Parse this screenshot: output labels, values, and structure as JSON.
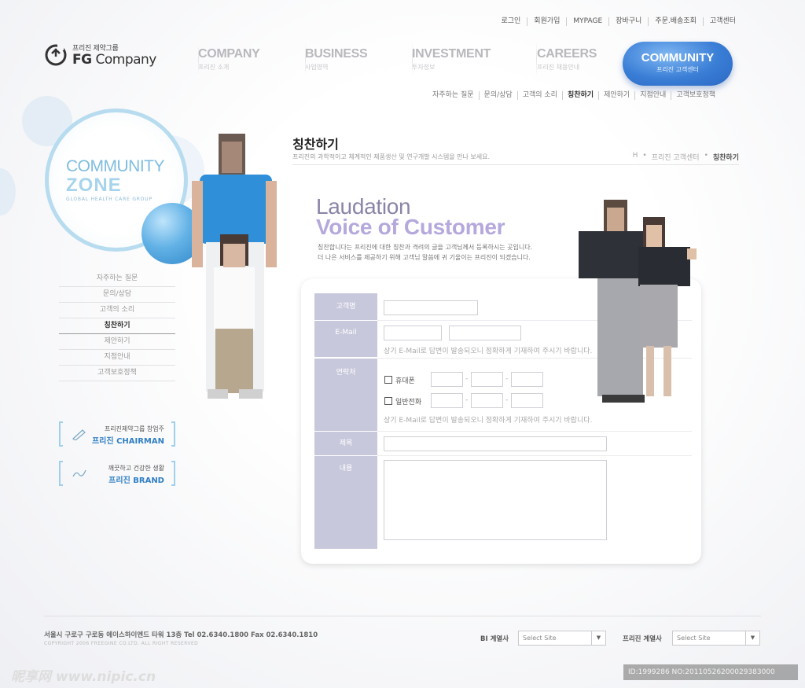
{
  "colors": {
    "accent": "#3a7ed6",
    "label_bg": "#c8c8dc",
    "zone": "#7fbde0"
  },
  "top_util": [
    "로그인",
    "회원가입",
    "MYPAGE",
    "장바구니",
    "주문.배송조회",
    "고객센터"
  ],
  "logo": {
    "sub": "프리진 제약그룹",
    "main_bold": "FG",
    "main": "Company",
    "icon": "logo-cycle-icon"
  },
  "gnb": [
    {
      "en": "COMPANY",
      "ko": "프리진 소개"
    },
    {
      "en": "BUSINESS",
      "ko": "사업영역"
    },
    {
      "en": "INVESTMENT",
      "ko": "투자정보"
    },
    {
      "en": "CAREERS",
      "ko": "프리진 채용안내"
    },
    {
      "en": "COMMUNITY",
      "ko": "프리진 고객센터"
    }
  ],
  "sub_nav": [
    "자주하는 질문",
    "문의/상담",
    "고객의 소리",
    "칭찬하기",
    "제안하기",
    "지점안내",
    "고객보호정책"
  ],
  "sub_nav_active": "칭찬하기",
  "zone": {
    "title": "COMMUNITY",
    "title2": "ZONE",
    "sub": "GLOBAL HEALTH CARE GROUP"
  },
  "lnb": [
    "자주하는 질문",
    "문의/상담",
    "고객의 소리",
    "칭찬하기",
    "제안하기",
    "지점안내",
    "고객보호정책"
  ],
  "banners": [
    {
      "line1": "프리진제약그룹 창업주",
      "line2": "프리진 CHAIRMAN",
      "icon": "pen-icon"
    },
    {
      "line1": "깨끗하고 건강한 생활",
      "line2": "프리진 BRAND",
      "icon": "hand-writing-icon"
    }
  ],
  "content": {
    "title": "칭찬하기",
    "desc": "프리진의 과학적이고 체계적인 제품생산 및 연구개발 시스템을 만나 보세요.",
    "breadcrumb": [
      "H",
      "프리진 고객센터",
      "칭찬하기"
    ],
    "laudation": "Laudation",
    "voc": "Voice of Customer",
    "intro1": "칭찬합니다는 프리진에 대한 칭찬과 격려의 글을 고객님께서 등록하시는 곳입니다.",
    "intro2": "더 나은 서비스를 제공하기 위해 고객님 말씀에 귀 기울이는 프리진이 되겠습니다."
  },
  "form": {
    "labels": [
      "고객명",
      "E-Mail",
      "연락처",
      "제목",
      "내용"
    ],
    "email_hint": "상기 E-Mail로 답변이 발송되오니 정확하게 기재하여 주시기 바랍니다.",
    "phone_options": [
      "휴대폰",
      "일반전화"
    ],
    "phone_hint": "상기 E-Mail로 답변이 발송되오니 정확하게 기재하여 주시기 바랍니다.",
    "dash": "-"
  },
  "footer": {
    "address": "서울시 구로구 구로동 에이스하이엔드 타워 13층   Tel 02.6340.1800   Fax 02.6340.1810",
    "copyright": "COPYRIGHT 2006 FREEGINE CO.LTD. ALL RIGHT RESERVED",
    "family1_label": "BI 계열사",
    "family2_label": "프리진 계열사",
    "select_value": "Select Site"
  },
  "watermark": {
    "left": "昵享网 www.nipic.cn",
    "right": "ID:1999286 NO:20110526200029383000"
  }
}
